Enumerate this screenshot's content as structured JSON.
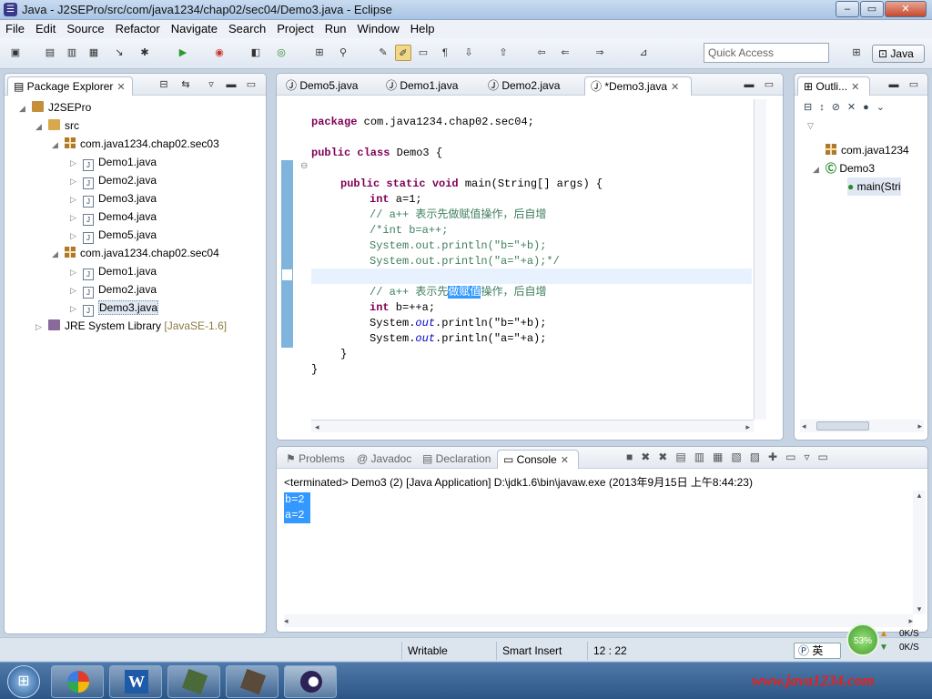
{
  "window": {
    "title": "Java - J2SEPro/src/com/java1234/chap02/sec04/Demo3.java - Eclipse",
    "min": "‒",
    "max": "▭",
    "close": "✕"
  },
  "menu": [
    "File",
    "Edit",
    "Source",
    "Refactor",
    "Navigate",
    "Search",
    "Project",
    "Run",
    "Window",
    "Help"
  ],
  "toolbar": {
    "quick_access_placeholder": "Quick Access",
    "perspective": "Java"
  },
  "package_explorer": {
    "tab": "Package Explorer",
    "project": "J2SEPro",
    "src": "src",
    "pkg1": "com.java1234.chap02.sec03",
    "pkg1_files": [
      "Demo1.java",
      "Demo2.java",
      "Demo3.java",
      "Demo4.java",
      "Demo5.java"
    ],
    "pkg2": "com.java1234.chap02.sec04",
    "pkg2_files": [
      "Demo1.java",
      "Demo2.java",
      "Demo3.java"
    ],
    "jre": "JRE System Library",
    "jre_version": "[JavaSE-1.6]"
  },
  "editor": {
    "tabs": [
      "Demo5.java",
      "Demo1.java",
      "Demo2.java",
      "*Demo3.java"
    ],
    "lines": {
      "l1a": "package",
      "l1b": " com.java1234.chap02.sec04;",
      "l2a": "public class",
      "l2b": " Demo3 {",
      "l3a": "public static void",
      "l3b": " main(String[] args) {",
      "l4a": "int",
      "l4b": " a=1;",
      "l5": "// a++ 表示先做赋值操作，后自增",
      "l6": "/*int b=a++;",
      "l7": "System.out.println(\"b=\"+b);",
      "l8": "System.out.println(\"a=\"+a);*/",
      "l9a": "// a++ 表示先",
      "l9b": "做赋值",
      "l9c": "操作，后自增",
      "l10a": "int",
      "l10b": " b=++a;",
      "l11a": "System.",
      "l11b": "out",
      "l11c": ".println(\"b=\"+b);",
      "l12a": "System.",
      "l12b": "out",
      "l12c": ".println(\"a=\"+a);",
      "l13": "}",
      "l14": "}"
    }
  },
  "outline": {
    "tab": "Outli...",
    "item1": "com.java1234",
    "item2": "Demo3",
    "item3": "main(Stri"
  },
  "console": {
    "tabs": [
      "Problems",
      "Javadoc",
      "Declaration",
      "Console"
    ],
    "status": "<terminated> Demo3 (2) [Java Application] D:\\jdk1.6\\bin\\javaw.exe (2013年9月15日 上午8:44:23)",
    "output": [
      "b=2",
      "a=2"
    ]
  },
  "statusbar": {
    "writable": "Writable",
    "insert_mode": "Smart Insert",
    "position": "12 : 22"
  },
  "tray": {
    "ime": "英",
    "cpu": "53%",
    "up": "0K/S",
    "down": "0K/S",
    "watermark": "www.java1234.com"
  },
  "colors": {
    "keyword": "#7f0055",
    "comment": "#3f7f5f",
    "selection": "#3399ff"
  }
}
